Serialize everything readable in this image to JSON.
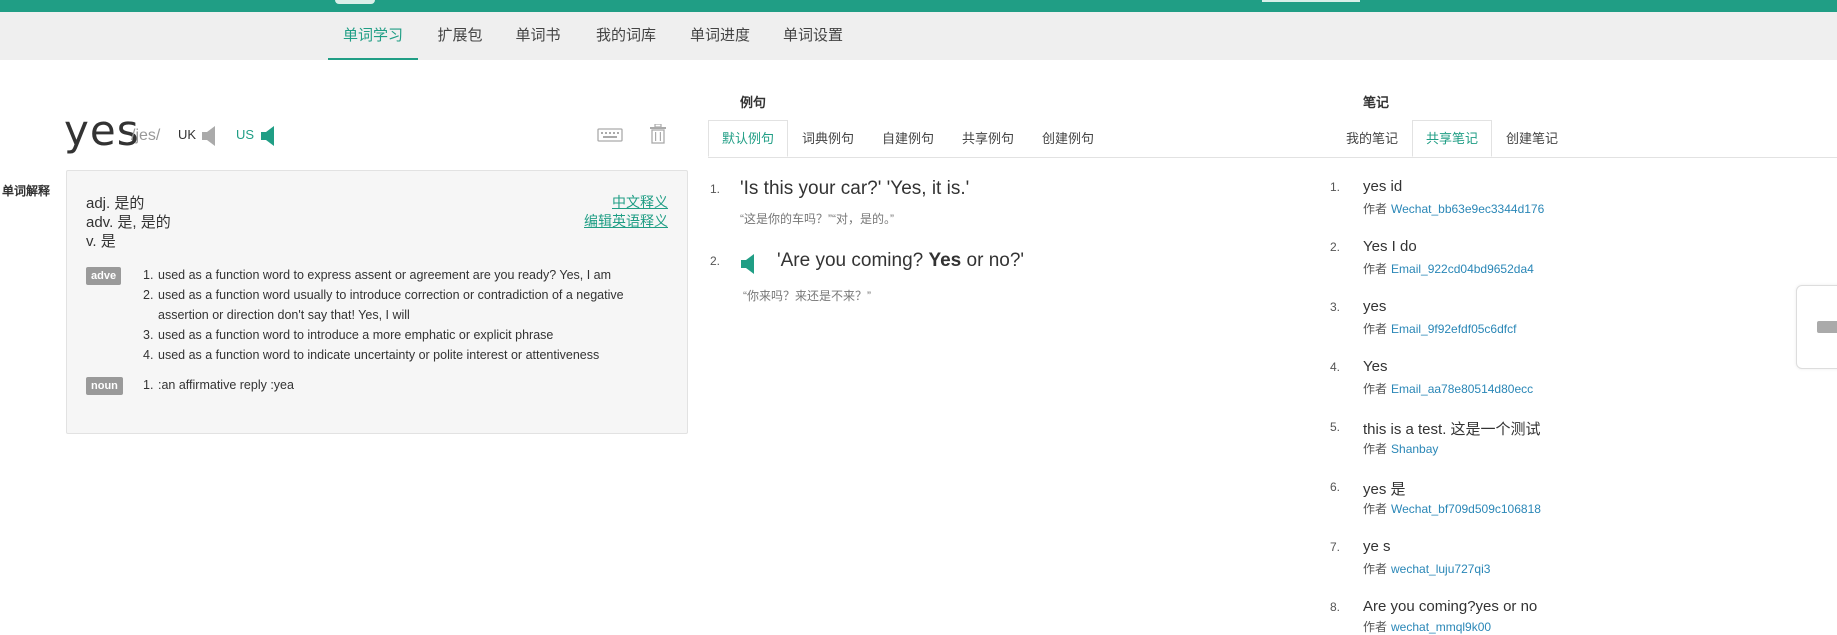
{
  "nav": {
    "tabs": [
      {
        "label": "单词学习",
        "active": true
      },
      {
        "label": "扩展包",
        "active": false
      },
      {
        "label": "单词书",
        "active": false
      },
      {
        "label": "我的词库",
        "active": false
      },
      {
        "label": "单词进度",
        "active": false
      },
      {
        "label": "单词设置",
        "active": false
      }
    ]
  },
  "word": {
    "text": "yes",
    "phonetic": "/jes/",
    "uk_label": "UK",
    "us_label": "US"
  },
  "side_label": "单词解释",
  "definitions": {
    "chinese": [
      "adj. 是的",
      "adv. 是, 是的",
      "v. 是"
    ],
    "links": {
      "chinese": "中文释义",
      "edit": "编辑",
      "english": "英语释义"
    },
    "english": [
      {
        "pos": "adve",
        "items": [
          {
            "num": "1.",
            "text": "used as a function word to express assent or agreement are you ready? Yes, I am"
          },
          {
            "num": "2.",
            "text": "used as a function word usually to introduce correction or contradiction of a negative assertion or direction don't say that! Yes, I will"
          },
          {
            "num": "3.",
            "text": "used as a function word to introduce a more emphatic or explicit phrase"
          },
          {
            "num": "4.",
            "text": "used as a function word to indicate uncertainty or polite interest or attentiveness"
          }
        ]
      },
      {
        "pos": "noun",
        "items": [
          {
            "num": "1.",
            "text": ":an affirmative reply :yea"
          }
        ]
      }
    ]
  },
  "examples": {
    "title": "例句",
    "tabs": [
      {
        "label": "默认例句",
        "active": true
      },
      {
        "label": "词典例句",
        "active": false
      },
      {
        "label": "自建例句",
        "active": false
      },
      {
        "label": "共享例句",
        "active": false
      },
      {
        "label": "创建例句",
        "active": false
      }
    ],
    "items": [
      {
        "num": "1.",
        "en": "'Is this your car?' 'Yes, it is.'",
        "cn": "“这是你的车吗？”“对，是的。”"
      },
      {
        "num": "2.",
        "en_before": "'Are you coming? ",
        "en_bold": "Yes",
        "en_after": " or no?'",
        "cn": "“你来吗？来还是不来？”"
      }
    ]
  },
  "notes": {
    "title": "笔记",
    "tabs": [
      {
        "label": "我的笔记",
        "active": false
      },
      {
        "label": "共享笔记",
        "active": true
      },
      {
        "label": "创建笔记",
        "active": false
      }
    ],
    "author_prefix": "作者",
    "items": [
      {
        "num": "1.",
        "text": "yes id",
        "author": "Wechat_bb63e9ec3344d176"
      },
      {
        "num": "2.",
        "text": "Yes I do",
        "author": "Email_922cd04bd9652da4"
      },
      {
        "num": "3.",
        "text": "yes",
        "author": "Email_9f92efdf05c6dfcf"
      },
      {
        "num": "4.",
        "text": "Yes",
        "author": "Email_aa78e80514d80ecc"
      },
      {
        "num": "5.",
        "text": "this is a test. 这是一个测试",
        "author": "Shanbay"
      },
      {
        "num": "6.",
        "text": "yes 是",
        "author": "Wechat_bf709d509c106818"
      },
      {
        "num": "7.",
        "text": "ye s",
        "author": "wechat_luju727qi3"
      },
      {
        "num": "8.",
        "text": "Are you coming?yes or no",
        "author": "wechat_mmql9k00"
      }
    ]
  },
  "colors": {
    "accent": "#209e85",
    "link": "#2a87b7",
    "badge": "#9a9a9a"
  },
  "icons": [
    "speaker-icon",
    "keyboard-icon",
    "trash-icon"
  ]
}
